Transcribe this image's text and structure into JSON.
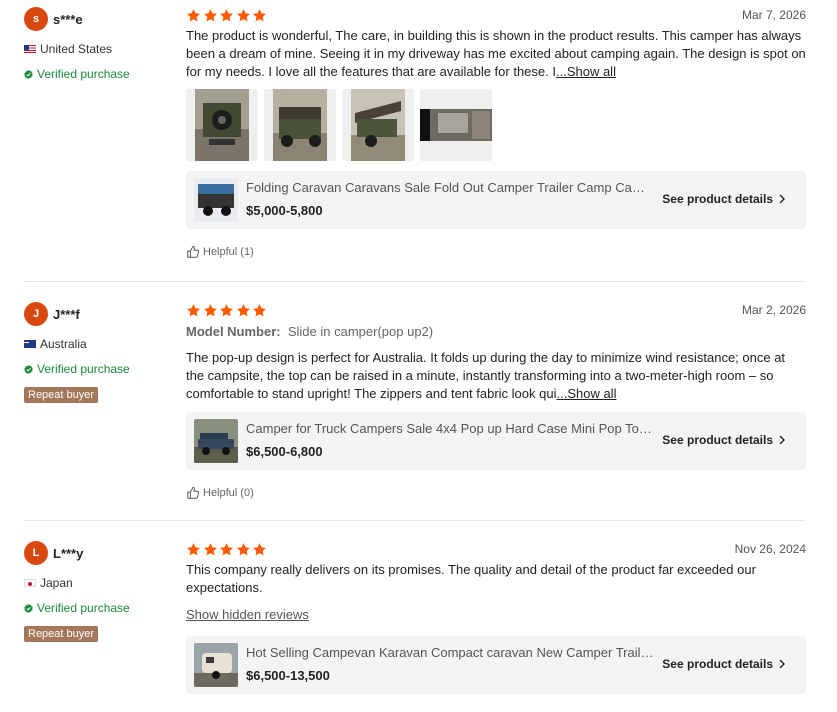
{
  "reviews": [
    {
      "avatar_letter": "s",
      "name": "s***e",
      "country": "United States",
      "verified": "Verified purchase",
      "repeat_buyer": "",
      "date": "Mar 7, 2026",
      "rating": 5,
      "model_label": "",
      "model_value": "",
      "text": "The product is wonderful, The care, in building this is shown in the product results. This camper has always been a dream of mine. Seeing it in my driveway has me excited about camping again. The design is spot on for my needs. I love all the features that are available for these. I",
      "show_all": "...Show all",
      "photos_count": 4,
      "product": {
        "title": "Folding Caravan Caravans Sale Fold Out Camper Trailer Camp Camper Off Road",
        "price": "$5,000-5,800",
        "details": "See product details"
      },
      "helpful": "Helpful (1)"
    },
    {
      "avatar_letter": "J",
      "name": "J***f",
      "country": "Australia",
      "verified": "Verified purchase",
      "repeat_buyer": "Repeat buyer",
      "date": "Mar 2, 2026",
      "rating": 5,
      "model_label": "Model Number:",
      "model_value": "Slide in camper(pop up2)",
      "text": "The pop-up design is perfect for Australia. It folds up during the day to minimize wind resistance; once at the campsite, the top can be raised in a minute, instantly transforming into a two-meter-high room – so comfortable to stand upright! The zippers and tent fabric look qui",
      "show_all": "...Show all",
      "product": {
        "title": "Camper for Truck Campers Sale 4x4 Pop up Hard Case Mini Pop Top Camper",
        "price": "$6,500-6,800",
        "details": "See product details"
      },
      "helpful": "Helpful (0)"
    },
    {
      "avatar_letter": "L",
      "name": "L***y",
      "country": "Japan",
      "verified": "Verified purchase",
      "repeat_buyer": "Repeat buyer",
      "date": "Nov 26, 2024",
      "rating": 5,
      "text": "This company really delivers on its promises. The quality and detail of the product far exceeded our expectations.",
      "show_hidden": "Show hidden reviews",
      "product": {
        "title": "Hot Selling Campevan Karavan Compact caravan New Camper Trailer Caravan",
        "price": "$6,500-13,500",
        "details": "See product details"
      }
    }
  ],
  "colors": {
    "star": "#ff5a00",
    "avatar": "#d9480f",
    "verified": "#1a8a3a",
    "repeat_badge": "#a5775a",
    "card_bg": "#f4f4f4"
  }
}
